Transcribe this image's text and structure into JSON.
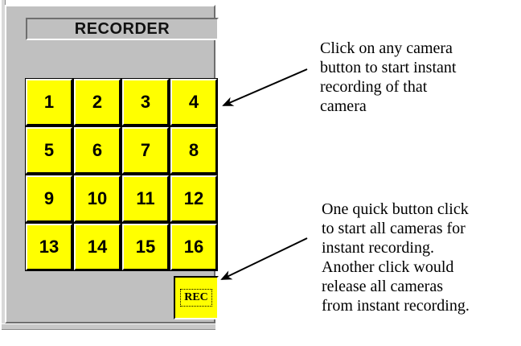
{
  "recorder": {
    "title": "RECORDER",
    "camera_buttons": [
      "1",
      "2",
      "3",
      "4",
      "5",
      "6",
      "7",
      "8",
      "9",
      "10",
      "11",
      "12",
      "13",
      "14",
      "15",
      "16"
    ],
    "button_color": "#ffff00",
    "rec_button_label": "REC"
  },
  "annotations": {
    "camera_note": [
      "Click on any camera",
      "button to start instant",
      "recording of that",
      "camera"
    ],
    "rec_note": [
      "One quick button click",
      "to start all cameras for",
      "instant recording.",
      "Another click would",
      "release all cameras",
      "from instant recording."
    ]
  }
}
